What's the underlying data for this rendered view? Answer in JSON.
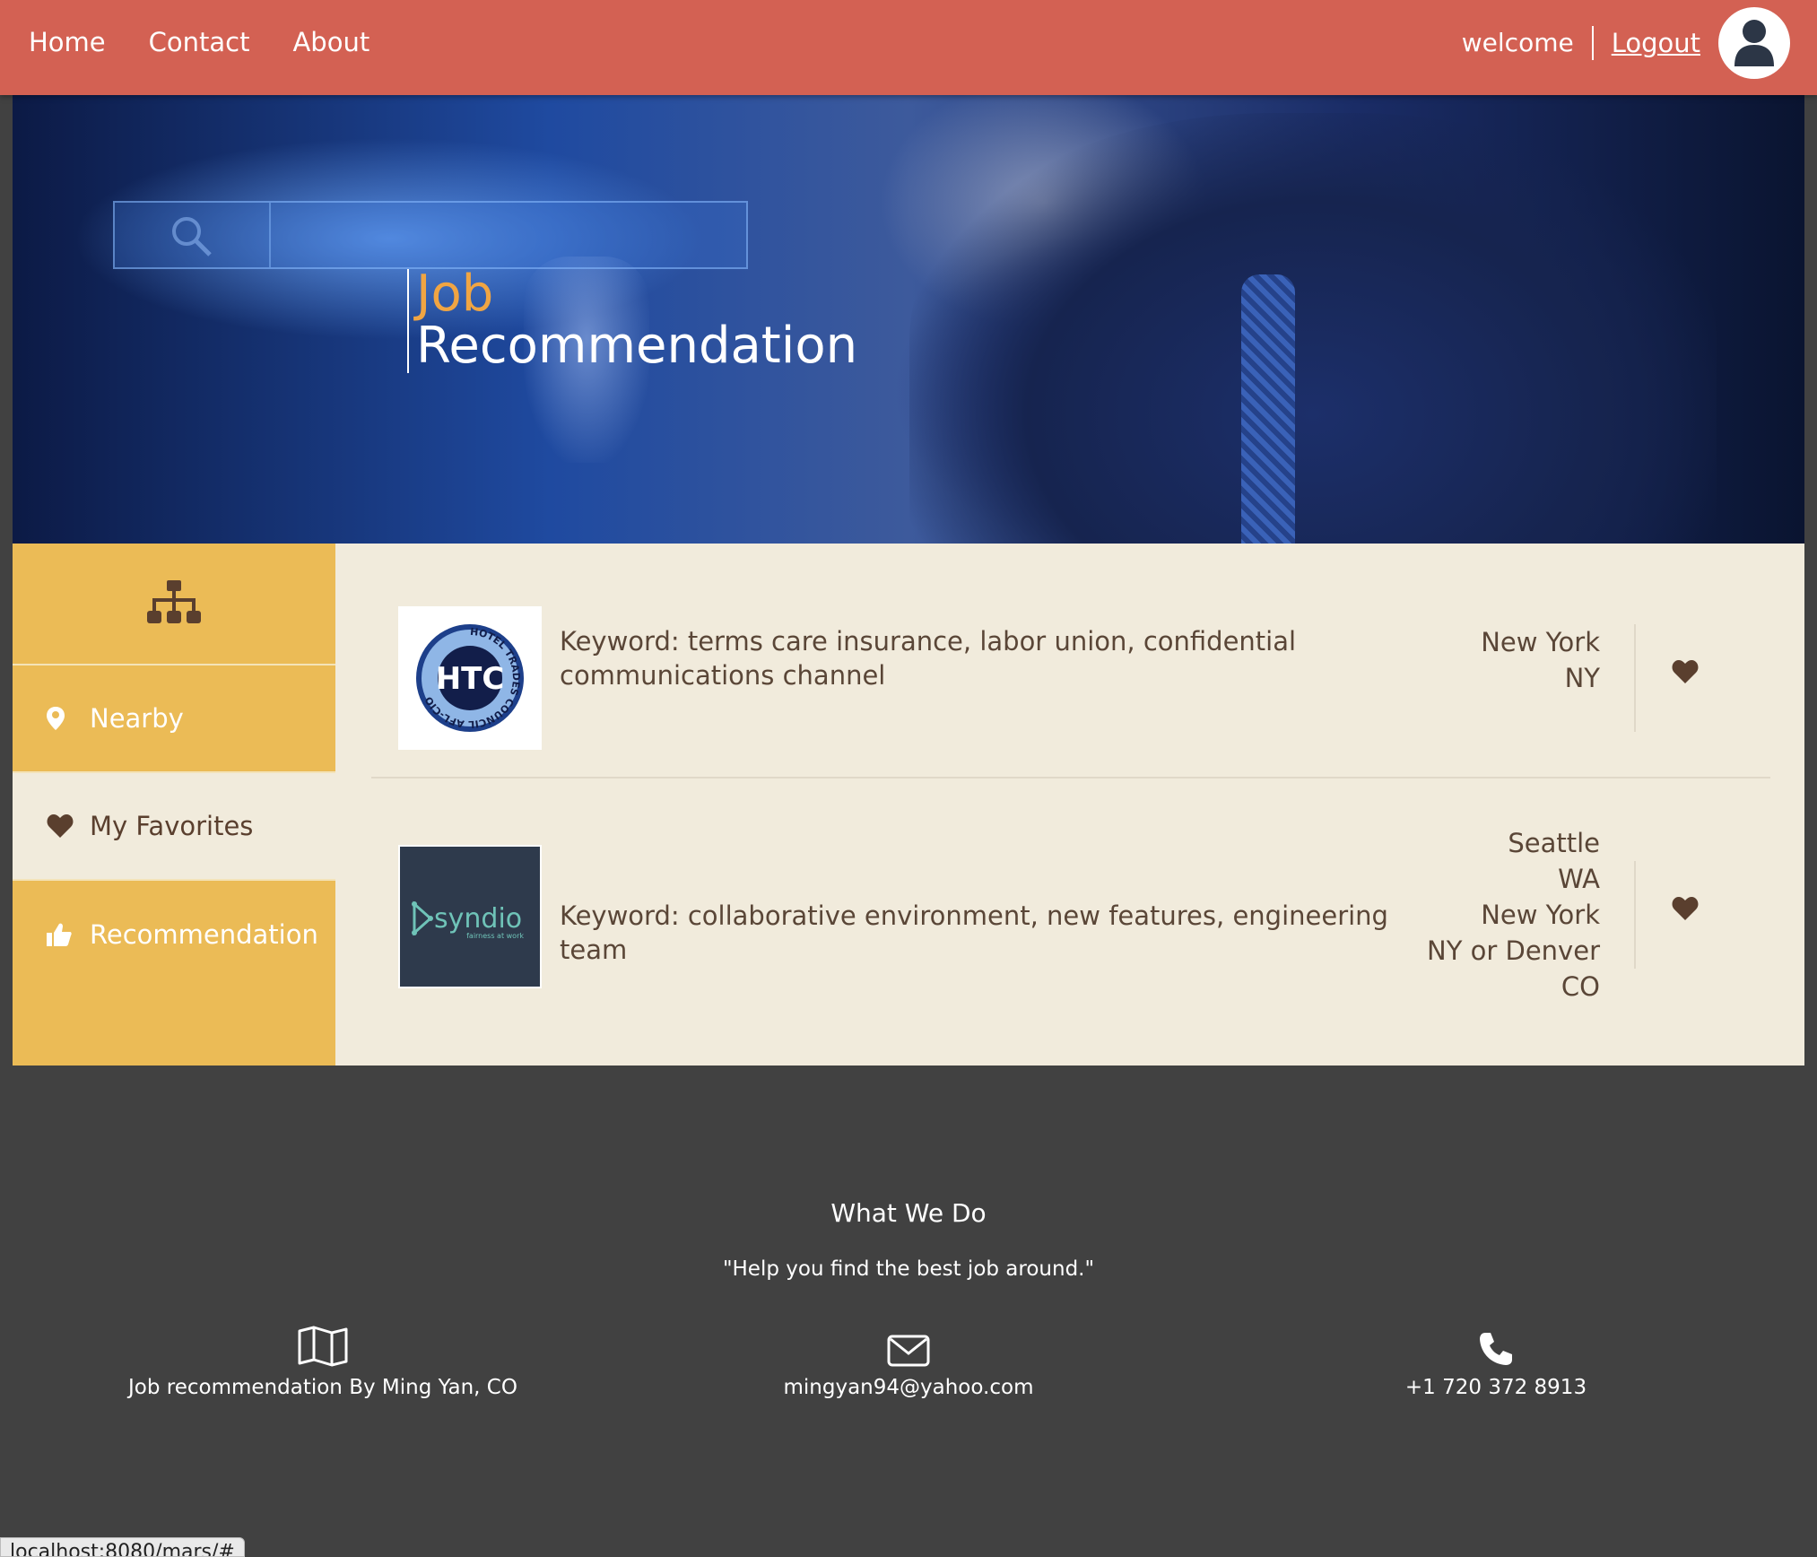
{
  "nav": {
    "items": [
      "Home",
      "Contact",
      "About"
    ],
    "welcome": "welcome",
    "logout": "Logout"
  },
  "hero": {
    "title_line1": "Job",
    "title_line2": "Recommendation"
  },
  "sidebar": {
    "items": [
      {
        "label": "Nearby",
        "icon": "map-marker-icon"
      },
      {
        "label": "My Favorites",
        "icon": "heart-icon"
      },
      {
        "label": "Recommendation",
        "icon": "thumbs-up-icon"
      }
    ]
  },
  "jobs": [
    {
      "logo_text": "HTC",
      "logo_ring_text": "HOTEL TRADES COUNCIL AFL-CIO",
      "keyword": "Keyword: terms care insurance, labor union, confidential communications channel",
      "location": [
        "New York",
        "NY"
      ]
    },
    {
      "logo_text": "syndio",
      "logo_tagline": "fairness at work",
      "keyword": "Keyword: collaborative environment, new features, engineering team",
      "location": [
        "Seattle",
        "WA",
        "New York",
        "NY or Denver",
        "CO"
      ]
    }
  ],
  "footer": {
    "heading": "What We Do",
    "quote": "\"Help you find the best job around.\"",
    "address": "Job recommendation By Ming Yan, CO",
    "email": "mingyan94@yahoo.com",
    "phone": "+1 720 372 8913"
  },
  "status_url": "localhost:8080/mars/#",
  "colors": {
    "topbar": "#d36153",
    "sidebar": "#ebbb56",
    "content_bg": "#f1ebdc",
    "footer": "#414141",
    "accent_title": "#f0a543",
    "icon_brown": "#5a3f2e"
  }
}
